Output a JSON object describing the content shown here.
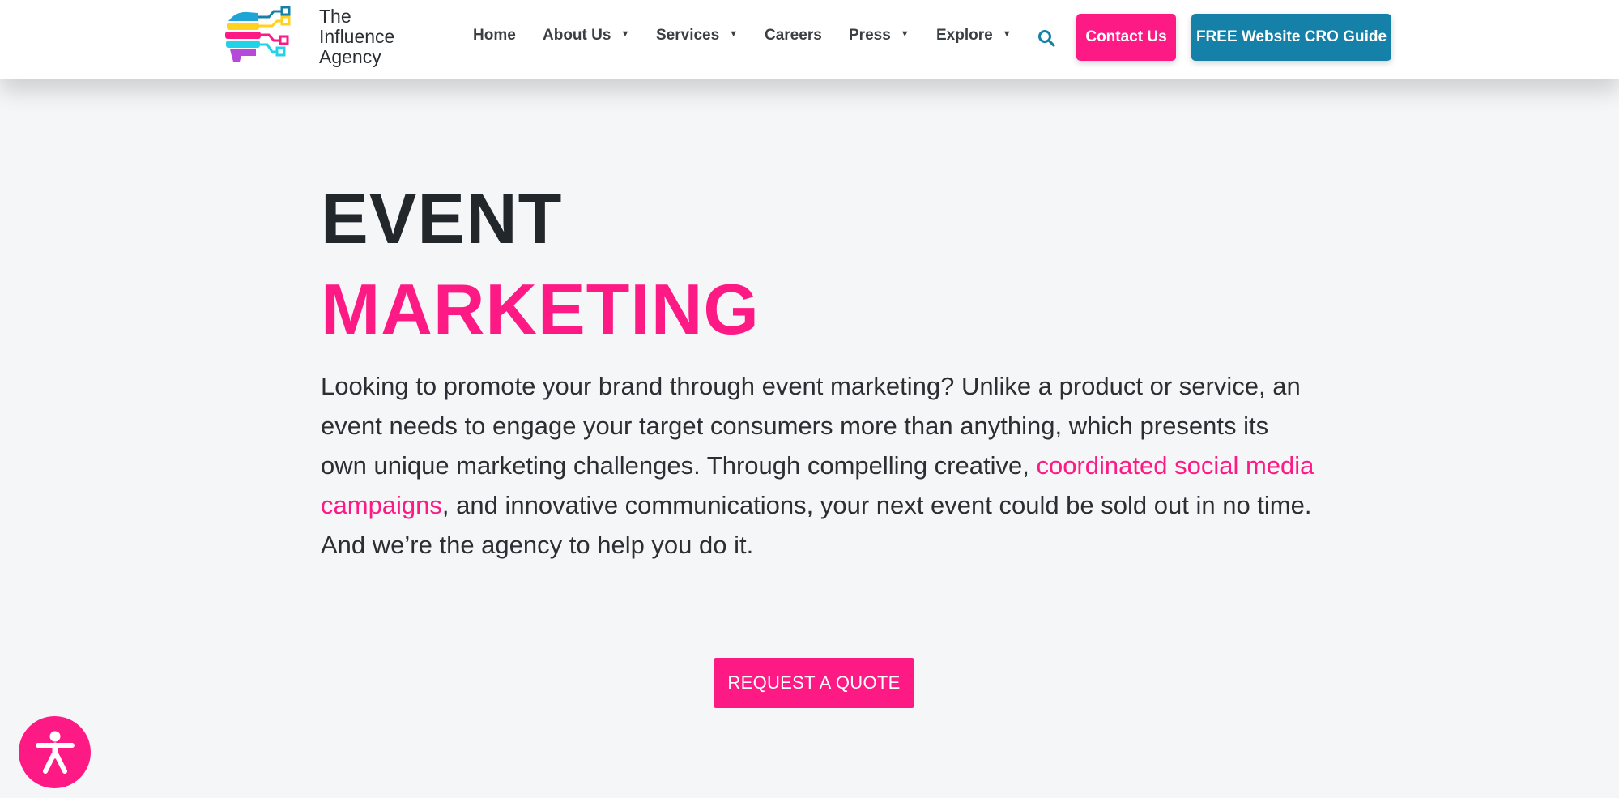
{
  "brand": {
    "logo_lines": [
      "The",
      "Influence",
      "Agency"
    ],
    "logo_icon": "brain-circuit-logo-icon",
    "colors": {
      "pink": "#fe1a84",
      "blue": "#1580a8",
      "dark": "#22272b",
      "background": "#f5f6f8"
    }
  },
  "nav": {
    "items": [
      {
        "label": "Home",
        "dropdown": false
      },
      {
        "label": "About Us",
        "dropdown": true
      },
      {
        "label": "Services",
        "dropdown": true
      },
      {
        "label": "Careers",
        "dropdown": false
      },
      {
        "label": "Press",
        "dropdown": true
      },
      {
        "label": "Explore",
        "dropdown": true
      }
    ],
    "search_icon": "search-icon",
    "contact_label": "Contact Us",
    "guide_label": "FREE Website CRO Guide"
  },
  "hero": {
    "title_line1": "EVENT",
    "title_line2": "MARKETING",
    "paragraph_before_link": "Looking to promote your brand through event marketing? Unlike a product or service, an event needs to engage your target consumers more than anything, which presents its own unique marketing challenges. Through compelling creative, ",
    "link_text": "coordinated social media campaigns",
    "paragraph_after_link": ", and innovative communications, your next event could be sold out in no time. And we’re the agency to help you do it.",
    "cta_label": "REQUEST A QUOTE"
  },
  "accessibility": {
    "icon": "accessibility-person-icon"
  }
}
